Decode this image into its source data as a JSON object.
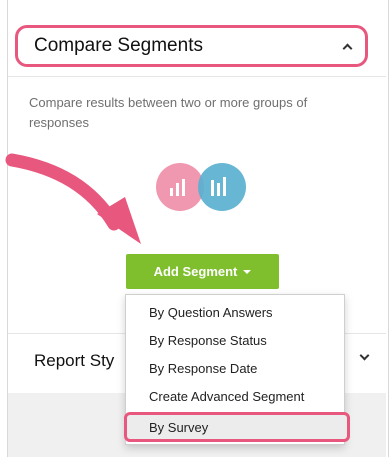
{
  "compare_segments": {
    "title": "Compare Segments",
    "description": "Compare results between two or more groups of responses",
    "add_segment_label": "Add Segment",
    "menu": [
      "By Question Answers",
      "By Response Status",
      "By Response Date",
      "Create Advanced Segment",
      "By Survey"
    ]
  },
  "report_style": {
    "title": "Report Sty"
  },
  "colors": {
    "highlight": "#e8577e",
    "button_green": "#7fbf2e",
    "circle_pink": "#ef8fa9",
    "circle_blue": "#5ab0cf"
  },
  "icons": [
    "chevron-up-icon",
    "chevron-down-icon",
    "compare-segments-icon",
    "arrow-icon",
    "caret-down-icon"
  ]
}
